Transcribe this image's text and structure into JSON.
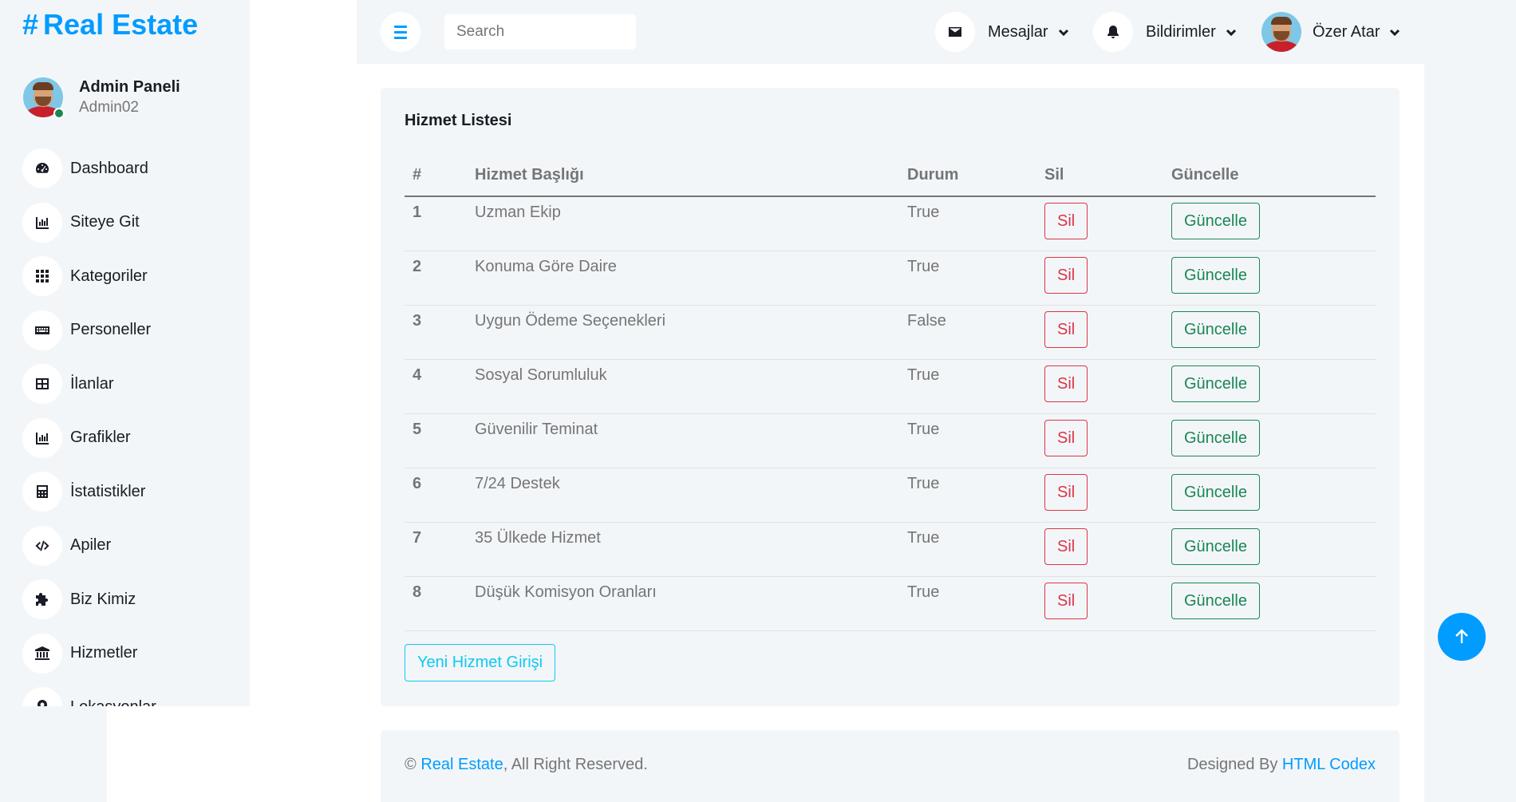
{
  "brand": {
    "hash": "#",
    "name": "Real Estate"
  },
  "profile": {
    "name": "Admin Paneli",
    "role": "Admin02"
  },
  "sidebar": {
    "items": [
      {
        "label": "Dashboard",
        "icon": "tachometer-icon"
      },
      {
        "label": "Siteye Git",
        "icon": "chart-bar-icon"
      },
      {
        "label": "Kategoriler",
        "icon": "grid-icon"
      },
      {
        "label": "Personeller",
        "icon": "keyboard-icon"
      },
      {
        "label": "İlanlar",
        "icon": "table-icon"
      },
      {
        "label": "Grafikler",
        "icon": "chart-bar-icon"
      },
      {
        "label": "İstatistikler",
        "icon": "calculator-icon"
      },
      {
        "label": "Apiler",
        "icon": "code-icon"
      },
      {
        "label": "Biz Kimiz",
        "icon": "puzzle-icon"
      },
      {
        "label": "Hizmetler",
        "icon": "bank-icon"
      },
      {
        "label": "Lokasyonlar",
        "icon": "map-pin-icon"
      }
    ]
  },
  "topbar": {
    "search_placeholder": "Search",
    "messages_label": "Mesajlar",
    "notifications_label": "Bildirimler",
    "user_name": "Özer Atar"
  },
  "card": {
    "title": "Hizmet Listesi",
    "headers": {
      "num": "#",
      "title": "Hizmet Başlığı",
      "status": "Durum",
      "delete": "Sil",
      "update": "Güncelle"
    },
    "rows": [
      {
        "num": "1",
        "title": "Uzman Ekip",
        "status": "True"
      },
      {
        "num": "2",
        "title": "Konuma Göre Daire",
        "status": "True"
      },
      {
        "num": "3",
        "title": "Uygun Ödeme Seçenekleri",
        "status": "False"
      },
      {
        "num": "4",
        "title": "Sosyal Sorumluluk",
        "status": "True"
      },
      {
        "num": "5",
        "title": "Güvenilir Teminat",
        "status": "True"
      },
      {
        "num": "6",
        "title": "7/24 Destek",
        "status": "True"
      },
      {
        "num": "7",
        "title": "35 Ülkede Hizmet",
        "status": "True"
      },
      {
        "num": "8",
        "title": "Düşük Komisyon Oranları",
        "status": "True"
      }
    ],
    "delete_label": "Sil",
    "update_label": "Güncelle",
    "new_button_label": "Yeni Hizmet Girişi"
  },
  "footer": {
    "copyright_symbol": "©",
    "brand_link": "Real Estate",
    "rights_text": ", All Right Reserved.",
    "designed_by": "Designed By",
    "designer_link": "HTML Codex"
  },
  "colors": {
    "primary": "#009cff",
    "danger": "#dc3545",
    "success": "#198754",
    "info": "#0dcaf0",
    "panel_bg": "#f3f6f9",
    "dark": "#191c24"
  }
}
